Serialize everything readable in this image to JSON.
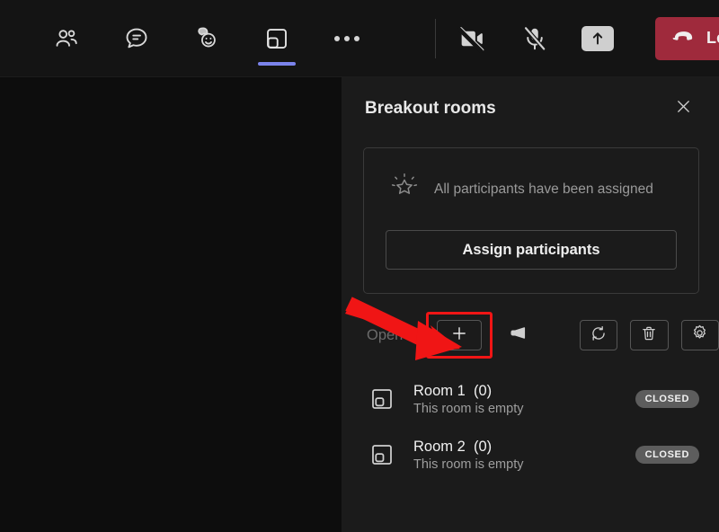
{
  "meeting_toolbar": {
    "left_items": [
      {
        "name": "people-icon",
        "label": "People"
      },
      {
        "name": "chat-icon",
        "label": "Chat"
      },
      {
        "name": "reactions-icon",
        "label": "Reactions"
      },
      {
        "name": "breakout-rooms-icon",
        "label": "Breakout rooms",
        "active": true
      },
      {
        "name": "more-options-icon",
        "label": "More"
      }
    ],
    "right_items": [
      {
        "name": "camera-off-icon",
        "label": "Camera off"
      },
      {
        "name": "microphone-muted-icon",
        "label": "Mic muted"
      },
      {
        "name": "share-screen-icon",
        "label": "Share"
      }
    ],
    "leave": {
      "label": "Leave",
      "icon": "hangup-phone-icon",
      "caret_icon": "chevron-down-icon",
      "color": "#9f2a3c"
    },
    "active_tab_accent": "#7b83eb"
  },
  "panel": {
    "title": "Breakout rooms",
    "close_icon": "close-icon",
    "assign_card": {
      "status_icon": "sparkle-star-icon",
      "status_text": "All participants have been assigned",
      "button_label": "Assign participants"
    },
    "actions": {
      "open_label": "Open",
      "add_room": {
        "icon": "plus-icon",
        "label": "Add room",
        "highlighted": true
      },
      "announcement": {
        "icon": "megaphone-icon",
        "label": "Make an announcement"
      },
      "recreate": {
        "icon": "refresh-icon",
        "label": "Recreate rooms"
      },
      "delete": {
        "icon": "trash-icon",
        "label": "Remove rooms"
      },
      "settings": {
        "icon": "gear-icon",
        "label": "Rooms settings"
      }
    },
    "rooms": [
      {
        "icon": "room-icon",
        "name": "Room 1",
        "count": "(0)",
        "subtitle": "This room is empty",
        "status": "CLOSED"
      },
      {
        "icon": "room-icon",
        "name": "Room 2",
        "count": "(0)",
        "subtitle": "This room is empty",
        "status": "CLOSED"
      }
    ]
  },
  "annotation": {
    "arrow_color": "#f01515",
    "highlight_color": "#f01515",
    "target": "add-room-button"
  }
}
